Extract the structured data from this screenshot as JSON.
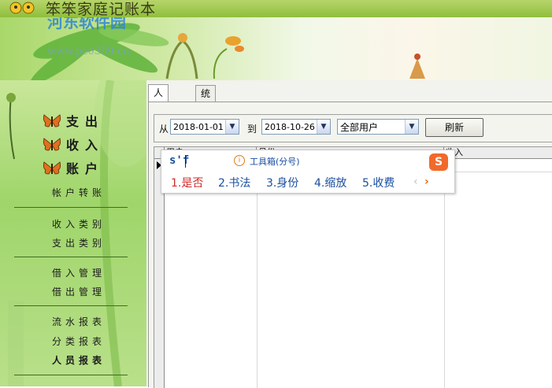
{
  "app": {
    "title": "笨笨家庭记账本"
  },
  "watermark": {
    "site_name": "河东软件园",
    "site_url": "www.pc0359.cn"
  },
  "sidebar": {
    "main_nav": [
      {
        "label": "支出"
      },
      {
        "label": "收入"
      },
      {
        "label": "账户"
      }
    ],
    "sub_nav_groups": [
      [
        {
          "label": "帐户转账"
        }
      ],
      [
        {
          "label": "收入类别"
        },
        {
          "label": "支出类别"
        }
      ],
      [
        {
          "label": "借入管理"
        },
        {
          "label": "借出管理"
        }
      ],
      [
        {
          "label": "流水报表"
        },
        {
          "label": "分类报表"
        },
        {
          "label": "人员报表",
          "active": true
        }
      ]
    ]
  },
  "tabs": [
    {
      "label": "人员报表",
      "selected": true
    },
    {
      "label": "统计图表",
      "selected": false
    }
  ],
  "filter": {
    "from_label": "从",
    "from_date": "2018-01-01",
    "to_label": "到",
    "to_date": "2018-10-26",
    "user_select": "全部用户",
    "refresh_label": "刷新"
  },
  "grid": {
    "columns": [
      "用户",
      "月份",
      "收入"
    ]
  },
  "ime": {
    "pinyin": "s'f",
    "hint": "工具箱(分号)",
    "candidates": [
      "1.是否",
      "2.书法",
      "3.身份",
      "4.缩放",
      "5.收费"
    ],
    "prev": "‹",
    "next": "›",
    "logo_char": "S"
  },
  "colors": {
    "accent_green": "#8fbf3c",
    "ime_blue": "#1a4fa0",
    "ime_red": "#d42b2b",
    "ime_orange": "#f16a2a"
  }
}
